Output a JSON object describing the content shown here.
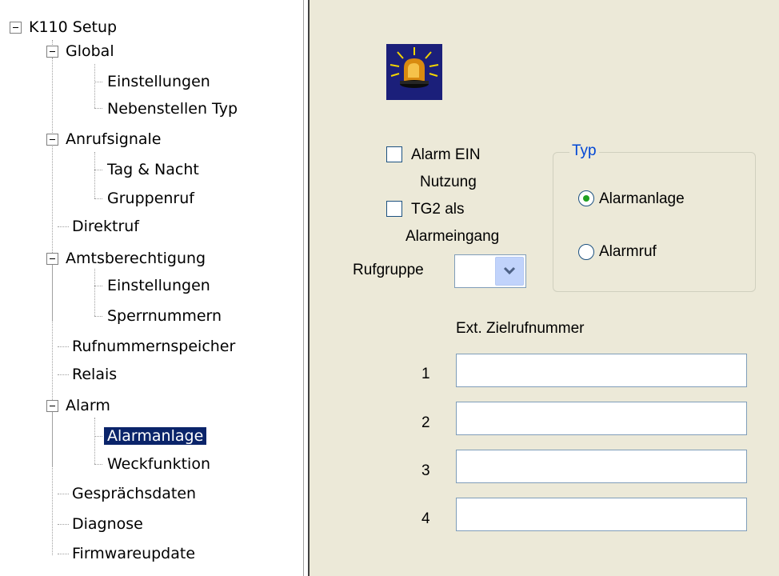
{
  "tree": {
    "root": "K110 Setup",
    "global": "Global",
    "global_einstellungen": "Einstellungen",
    "global_nebenstellen": "Nebenstellen Typ",
    "anrufsignale": "Anrufsignale",
    "tag_nacht": "Tag & Nacht",
    "gruppenruf": "Gruppenruf",
    "direktruf": "Direktruf",
    "amtsberechtigung": "Amtsberechtigung",
    "amts_einstellungen": "Einstellungen",
    "sperrnummern": "Sperrnummern",
    "rufnummernspeicher": "Rufnummernspeicher",
    "relais": "Relais",
    "alarm": "Alarm",
    "alarmanlage": "Alarmanlage",
    "weckfunktion": "Weckfunktion",
    "gespraechsdaten": "Gesprächsdaten",
    "diagnose": "Diagnose",
    "firmwareupdate": "Firmwareupdate",
    "selected": "Alarmanlage"
  },
  "panel": {
    "icon": "alarm-beacon-icon",
    "alarm_ein_label": "Alarm EIN",
    "alarm_ein_checked": false,
    "nutzung_label_1": "Nutzung",
    "nutzung_label_2": "TG2 als",
    "nutzung_label_3": "Alarmeingang",
    "nutzung_checked": false,
    "rufgruppe_label": "Rufgruppe",
    "rufgruppe_value": "",
    "typ_group_title": "Typ",
    "typ_options": [
      "Alarmanlage",
      "Alarmruf"
    ],
    "typ_selected": "Alarmanlage",
    "zielrufnummer_header": "Ext. Zielrufnummer",
    "rows": [
      {
        "label": "1",
        "value": ""
      },
      {
        "label": "2",
        "value": ""
      },
      {
        "label": "3",
        "value": ""
      },
      {
        "label": "4",
        "value": ""
      }
    ]
  },
  "colors": {
    "panel_bg": "#ece9d8",
    "selection_bg": "#0a246a",
    "group_title": "#0046d5",
    "radio_dot": "#21a121"
  }
}
